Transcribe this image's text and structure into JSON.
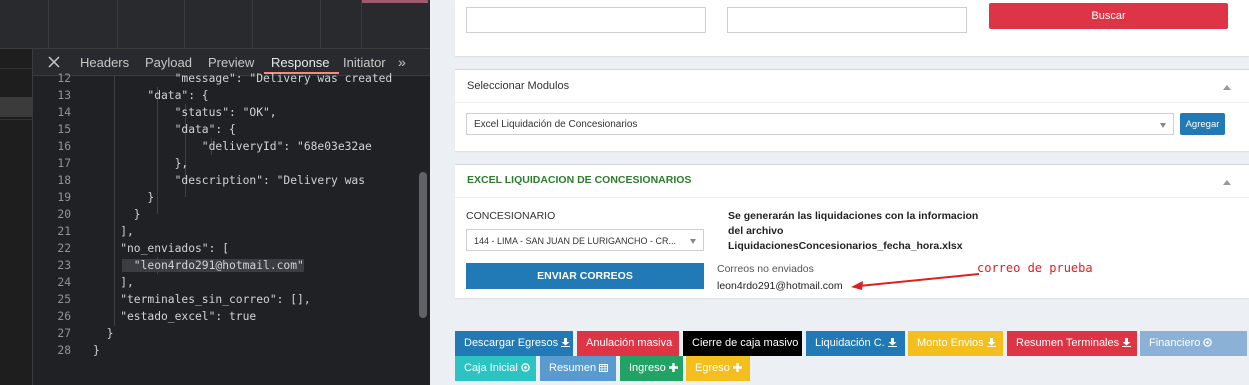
{
  "devtools": {
    "tabs": [
      {
        "label": "Headers"
      },
      {
        "label": "Payload"
      },
      {
        "label": "Preview"
      },
      {
        "label": "Response"
      },
      {
        "label": "Initiator"
      }
    ],
    "more_label": "»",
    "code_lines": [
      {
        "n": "12",
        "text": "\"message\": \"Delivery was created"
      },
      {
        "n": "13",
        "text": "\"data\": {"
      },
      {
        "n": "14",
        "text": "\"status\": \"OK\","
      },
      {
        "n": "15",
        "text": "\"data\": {"
      },
      {
        "n": "16",
        "text": "\"deliveryId\": \"68e03e32ae"
      },
      {
        "n": "17",
        "text": "},"
      },
      {
        "n": "18",
        "text": "\"description\": \"Delivery was"
      },
      {
        "n": "19",
        "text": "}"
      },
      {
        "n": "20",
        "text": "}"
      },
      {
        "n": "21",
        "text": "],"
      },
      {
        "n": "22",
        "text": "\"no_enviados\": ["
      },
      {
        "n": "23",
        "text": "\"leon4rdo291@hotmail.com\""
      },
      {
        "n": "24",
        "text": "],"
      },
      {
        "n": "25",
        "text": "\"terminales_sin_correo\": [],"
      },
      {
        "n": "26",
        "text": "\"estado_excel\": true"
      },
      {
        "n": "27",
        "text": "}"
      },
      {
        "n": "28",
        "text": "}"
      }
    ]
  },
  "search": {
    "button_label": "Buscar",
    "field1_value": "",
    "field2_value": ""
  },
  "modules": {
    "title": "Seleccionar Modulos",
    "selected": "Excel Liquidación de Concesionarios",
    "add_label": "Agregar"
  },
  "excel": {
    "title": "EXCEL LIQUIDACION DE CONCESIONARIOS",
    "concesionario_label": "CONCESIONARIO",
    "concesionario_selected": "144 - LIMA - SAN JUAN DE LURIGANCHO - CR...",
    "info_line1": "Se generarán las liquidaciones con la informacion",
    "info_line2": "del archivo",
    "info_line3": "LiquidacionesConcesionarios_fecha_hora.xlsx",
    "send_label": "ENVIAR CORREOS",
    "not_sent_label": "Correos no enviados",
    "not_sent_email": "leon4rdo291@hotmail.com",
    "annotation": "correo de prueba"
  },
  "actions": [
    {
      "label": "Descargar Egresos",
      "icon": "download-icon",
      "color": "#2179b5"
    },
    {
      "label": "Anulación masiva",
      "icon": "",
      "color": "#dd3545"
    },
    {
      "label": "Cierre de caja masivo",
      "icon": "",
      "color": "#000000"
    },
    {
      "label": "Liquidación C.",
      "icon": "download-icon",
      "color": "#2179b5"
    },
    {
      "label": "Monto Envios",
      "icon": "download-icon",
      "color": "#f3be1e"
    },
    {
      "label": "Resumen Terminales",
      "icon": "download-icon",
      "color": "#dd3545"
    },
    {
      "label": "Financiero",
      "icon": "circle-icon",
      "color": "#8bb2d6"
    },
    {
      "label": "Caja Inicial",
      "icon": "circle-icon",
      "color": "#2cc3c3"
    },
    {
      "label": "Resumen",
      "icon": "calendar-icon",
      "color": "#5a9bcf"
    },
    {
      "label": "Ingreso",
      "icon": "plus-icon",
      "color": "#22a366"
    },
    {
      "label": "Egreso",
      "icon": "plus-icon",
      "color": "#f3be1e"
    }
  ],
  "colors": {
    "danger": "#dd3545",
    "primary": "#2179b5",
    "success_title": "#2d7d2f",
    "annotation_red": "#e02020"
  }
}
